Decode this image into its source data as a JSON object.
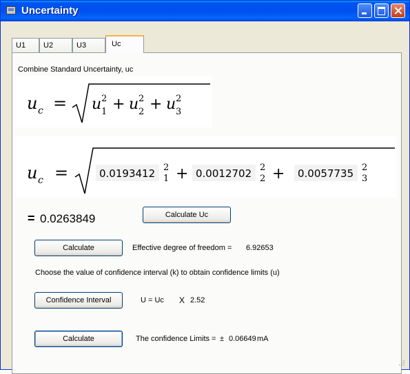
{
  "window": {
    "title": "Uncertainty"
  },
  "tabs": [
    {
      "label": "U1"
    },
    {
      "label": "U2"
    },
    {
      "label": "U3"
    },
    {
      "label": "Uc"
    }
  ],
  "panel": {
    "section_title": "Combine Standard Uncertainty, uc",
    "formula_symbolic": {
      "lhs": "u",
      "lhs_sub": "c",
      "equals": "=",
      "terms": [
        {
          "base": "u",
          "sub": "1",
          "sup": "2"
        },
        {
          "base": "u",
          "sub": "2",
          "sup": "2"
        },
        {
          "base": "u",
          "sub": "3",
          "sup": "2"
        }
      ],
      "plus": "+"
    },
    "formula_numeric": {
      "values": [
        "0.0193412",
        "0.0012702",
        "0.0057735"
      ],
      "subs": [
        "1",
        "2",
        "3"
      ],
      "sup": "2"
    },
    "result": {
      "equals": "=",
      "value": "0.0263849"
    },
    "calc_uc_button": "Calculate Uc",
    "calc_dof_button": "Calculate",
    "dof_label": "Effective degree of freedom =",
    "dof_value": "6.92653",
    "confidence_instruction": "Choose the value of confidence interval (k) to obtain confidence limits (u)",
    "confidence_button": "Confidence Interval",
    "u_formula": {
      "prefix": "U = Uc",
      "times": "X",
      "k": "2.52"
    },
    "calc_limits_button": "Calculate",
    "limits_label": "The confidence Limits =",
    "limits_pm": "±",
    "limits_value": "0.06649",
    "limits_unit": "mA"
  },
  "colors": {
    "titlebar": "#0053ee",
    "tab_highlight": "#f8b33f",
    "window_bg": "#ece9d8",
    "panel_bg": "#fbfbf9"
  }
}
